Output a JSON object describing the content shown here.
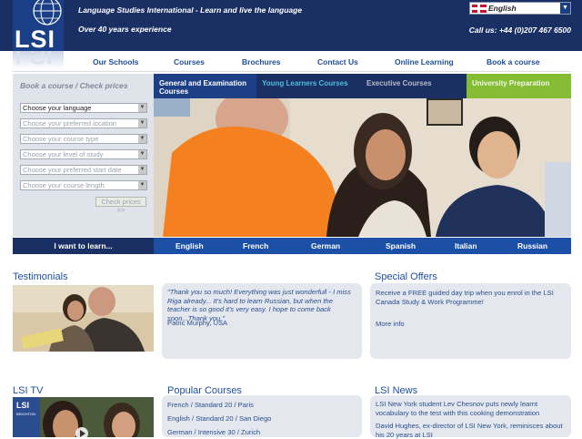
{
  "header": {
    "logo_text": "LSI",
    "tagline": "Language Studies International - Learn and live the language",
    "experience": "Over 40 years experience",
    "phone": "Call us: +44 (0)207 467 6500",
    "language_selector": "English"
  },
  "nav": {
    "items": [
      "Our Schools",
      "Courses",
      "Brochures",
      "Contact Us",
      "Online Learning",
      "Book a course"
    ]
  },
  "search": {
    "title": "Book a course / Check prices",
    "selects": [
      "Choose your language",
      "Choose your preferred location",
      "Choose your course type",
      "Choose your level of study",
      "Choose your preferred start date",
      "Choose your course length"
    ],
    "button": "Check prices >>"
  },
  "course_tabs": [
    "General and Examination Courses",
    "Young Learners Courses",
    "Executive Courses",
    "University Preparation"
  ],
  "language_bar": {
    "label": "I want to learn...",
    "languages": [
      "English",
      "French",
      "German",
      "Spanish",
      "Italian",
      "Russian"
    ]
  },
  "testimonials": {
    "title": "Testimonials",
    "quote": "\"Thank you so much! Everything was just wonderfull - I miss Riga already... It's hard to learn Russian, but when the teacher is so good it's very easy. I hope to come back soon...Thank you.\"",
    "author": "Patric Murphy, USA"
  },
  "special_offers": {
    "title": "Special Offers",
    "text": "Receive a FREE guided day trip when you enrol in the LSI Canada Study & Work Programme!",
    "more": "More info"
  },
  "lsi_tv": {
    "title": "LSI TV",
    "badge": "LSI",
    "badge_sub": "BRIGHTON"
  },
  "popular_courses": {
    "title": "Popular Courses",
    "items": [
      "French / Standard 20 / Paris",
      "English / Standard 20 / San Diego",
      "German / Intensive 30 / Zurich"
    ]
  },
  "lsi_news": {
    "title": "LSI News",
    "items": [
      "LSI New York student Lev Chesnov puts newly learnt vocabulary to the test with this cooking demonstration",
      "David Hughes, ex-director of LSI New York, reminisces about his 20 years at LSI"
    ]
  },
  "colors": {
    "header_bg": "#1a2f63",
    "nav_link": "#1f4e9a",
    "tab_general": "#1c3f86",
    "tab_university": "#84bd34",
    "language_bar": "#1c4fa6"
  }
}
